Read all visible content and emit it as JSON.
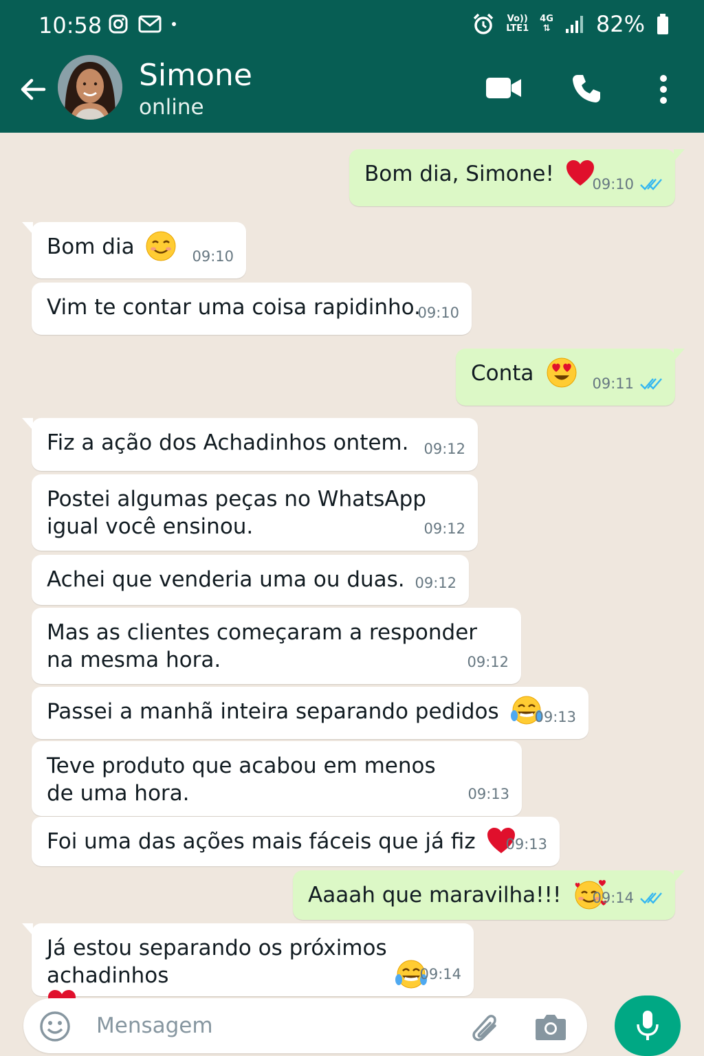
{
  "status_bar": {
    "time": "10:58",
    "network_top": "Vo))",
    "network_bottom": "LTE1",
    "gen": "4G",
    "battery": "82%"
  },
  "header": {
    "contact_name": "Simone",
    "contact_status": "online"
  },
  "messages": [
    {
      "dir": "out",
      "text": "Bom dia, Simone!",
      "emoji": "heart",
      "time": "09:10",
      "ticks": "read"
    },
    {
      "dir": "in",
      "text": "Bom dia",
      "emoji": "smiling",
      "time": "09:10"
    },
    {
      "dir": "in",
      "text": "Vim te contar uma coisa rapidinho.",
      "time": "09:10"
    },
    {
      "dir": "out",
      "text": "Conta",
      "emoji": "heart-eyes",
      "time": "09:11",
      "ticks": "read"
    },
    {
      "dir": "in",
      "text": "Fiz a ação dos Achadinhos ontem.",
      "time": "09:12"
    },
    {
      "dir": "in",
      "text": "Postei algumas peças no WhatsApp\nigual você ensinou.",
      "time": "09:12"
    },
    {
      "dir": "in",
      "text": "Achei que venderia uma ou duas.",
      "time": "09:12"
    },
    {
      "dir": "in",
      "text": "Mas as clientes começaram a responder\nna mesma hora.",
      "time": "09:12"
    },
    {
      "dir": "in",
      "text": "Passei a manhã inteira separando pedidos",
      "emoji": "tears-of-joy",
      "time": "09:13"
    },
    {
      "dir": "in",
      "text": "Teve produto que acabou em menos\nde uma hora.",
      "time": "09:13"
    },
    {
      "dir": "in",
      "text": "Foi uma das ações mais fáceis que já fiz",
      "emoji": "heart",
      "time": "09:13"
    },
    {
      "dir": "out",
      "text": "Aaaah que maravilha!!!",
      "emoji": "smiling-hearts",
      "time": "09:14",
      "ticks": "read"
    },
    {
      "dir": "in",
      "text": "Já estou separando os próximos\nachadinhos",
      "emoji": "tears-of-joy+heart",
      "time": "09:14"
    }
  ],
  "input": {
    "placeholder": "Mensagem"
  },
  "colors": {
    "header": "#075e54",
    "outgoing": "#dcf8c6",
    "incoming": "#ffffff",
    "background": "#efe7de",
    "read_ticks": "#34b7f1",
    "mic": "#00a884"
  }
}
